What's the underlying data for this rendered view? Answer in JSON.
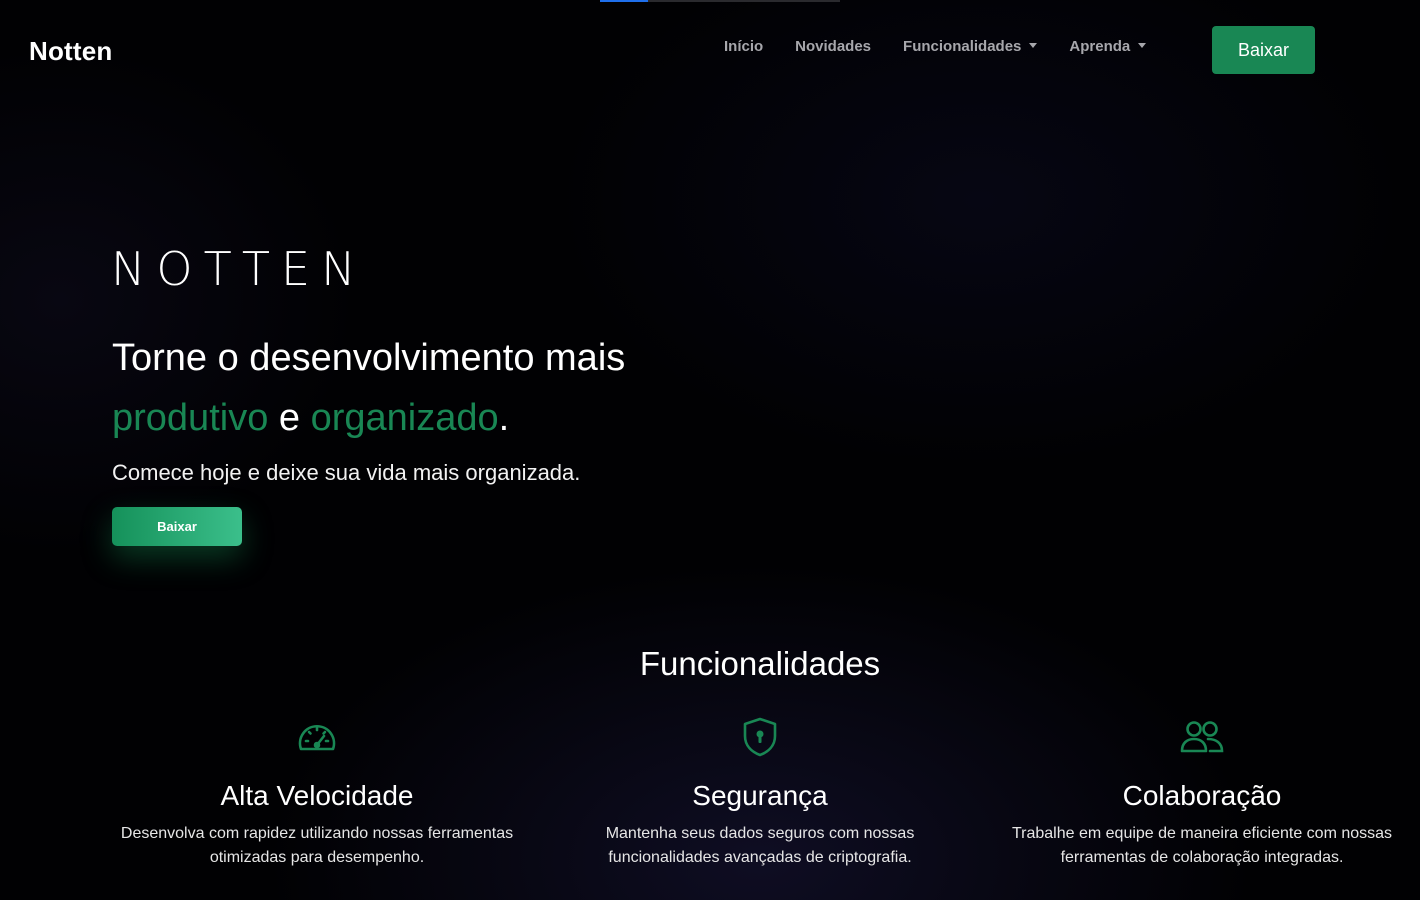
{
  "nav": {
    "brand": "Notten",
    "links": [
      "Início",
      "Novidades",
      "Funcionalidades",
      "Aprenda"
    ],
    "cta": "Baixar"
  },
  "hero": {
    "logo": "NOTTEN",
    "title_line1": "Torne o desenvolvimento mais",
    "accent1": "produtivo",
    "connector": "e",
    "accent2": "organizado",
    "period": ".",
    "subtitle": "Comece hoje e deixe sua vida mais organizada.",
    "cta": "Baixar"
  },
  "features": {
    "title": "Funcionalidades",
    "items": [
      {
        "icon": "speedometer-icon",
        "title": "Alta Velocidade",
        "description": "Desenvolva com rapidez utilizando nossas ferramentas otimizadas para desempenho."
      },
      {
        "icon": "shield-lock-icon",
        "title": "Segurança",
        "description": "Mantenha seus dados seguros com nossas funcionalidades avançadas de criptografia."
      },
      {
        "icon": "people-icon",
        "title": "Colaboração",
        "description": "Trabalhe em equipe de maneira eficiente com nossas ferramentas de colaboração integradas."
      }
    ]
  },
  "colors": {
    "accent": "#198754",
    "background": "#000000",
    "progress": "#1f6feb"
  },
  "progress": 0.2
}
